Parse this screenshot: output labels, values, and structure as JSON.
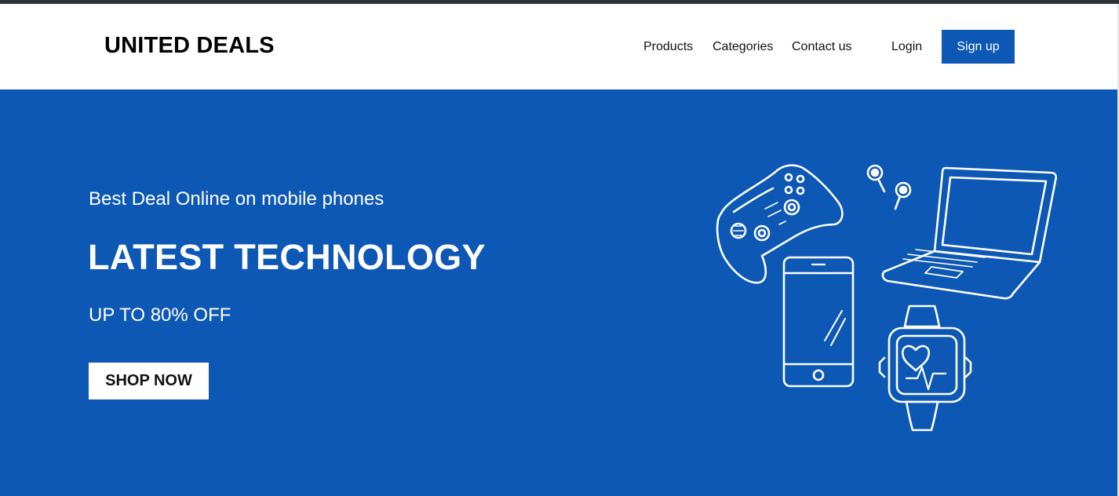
{
  "header": {
    "brand": "UNITED DEALS",
    "nav": {
      "products": "Products",
      "categories": "Categories",
      "contact": "Contact us",
      "login": "Login",
      "signup": "Sign up"
    }
  },
  "hero": {
    "tagline": "Best Deal Online on mobile phones",
    "title": "LATEST TECHNOLOGY",
    "offer": "UP TO 80% OFF",
    "cta": "SHOP NOW",
    "illustration_icons": [
      "game-controller-icon",
      "earbuds-icon",
      "laptop-icon",
      "smartphone-icon",
      "smartwatch-icon"
    ]
  },
  "colors": {
    "brand_blue": "#0d58b5",
    "top_strip": "#2e3338",
    "white": "#ffffff"
  }
}
